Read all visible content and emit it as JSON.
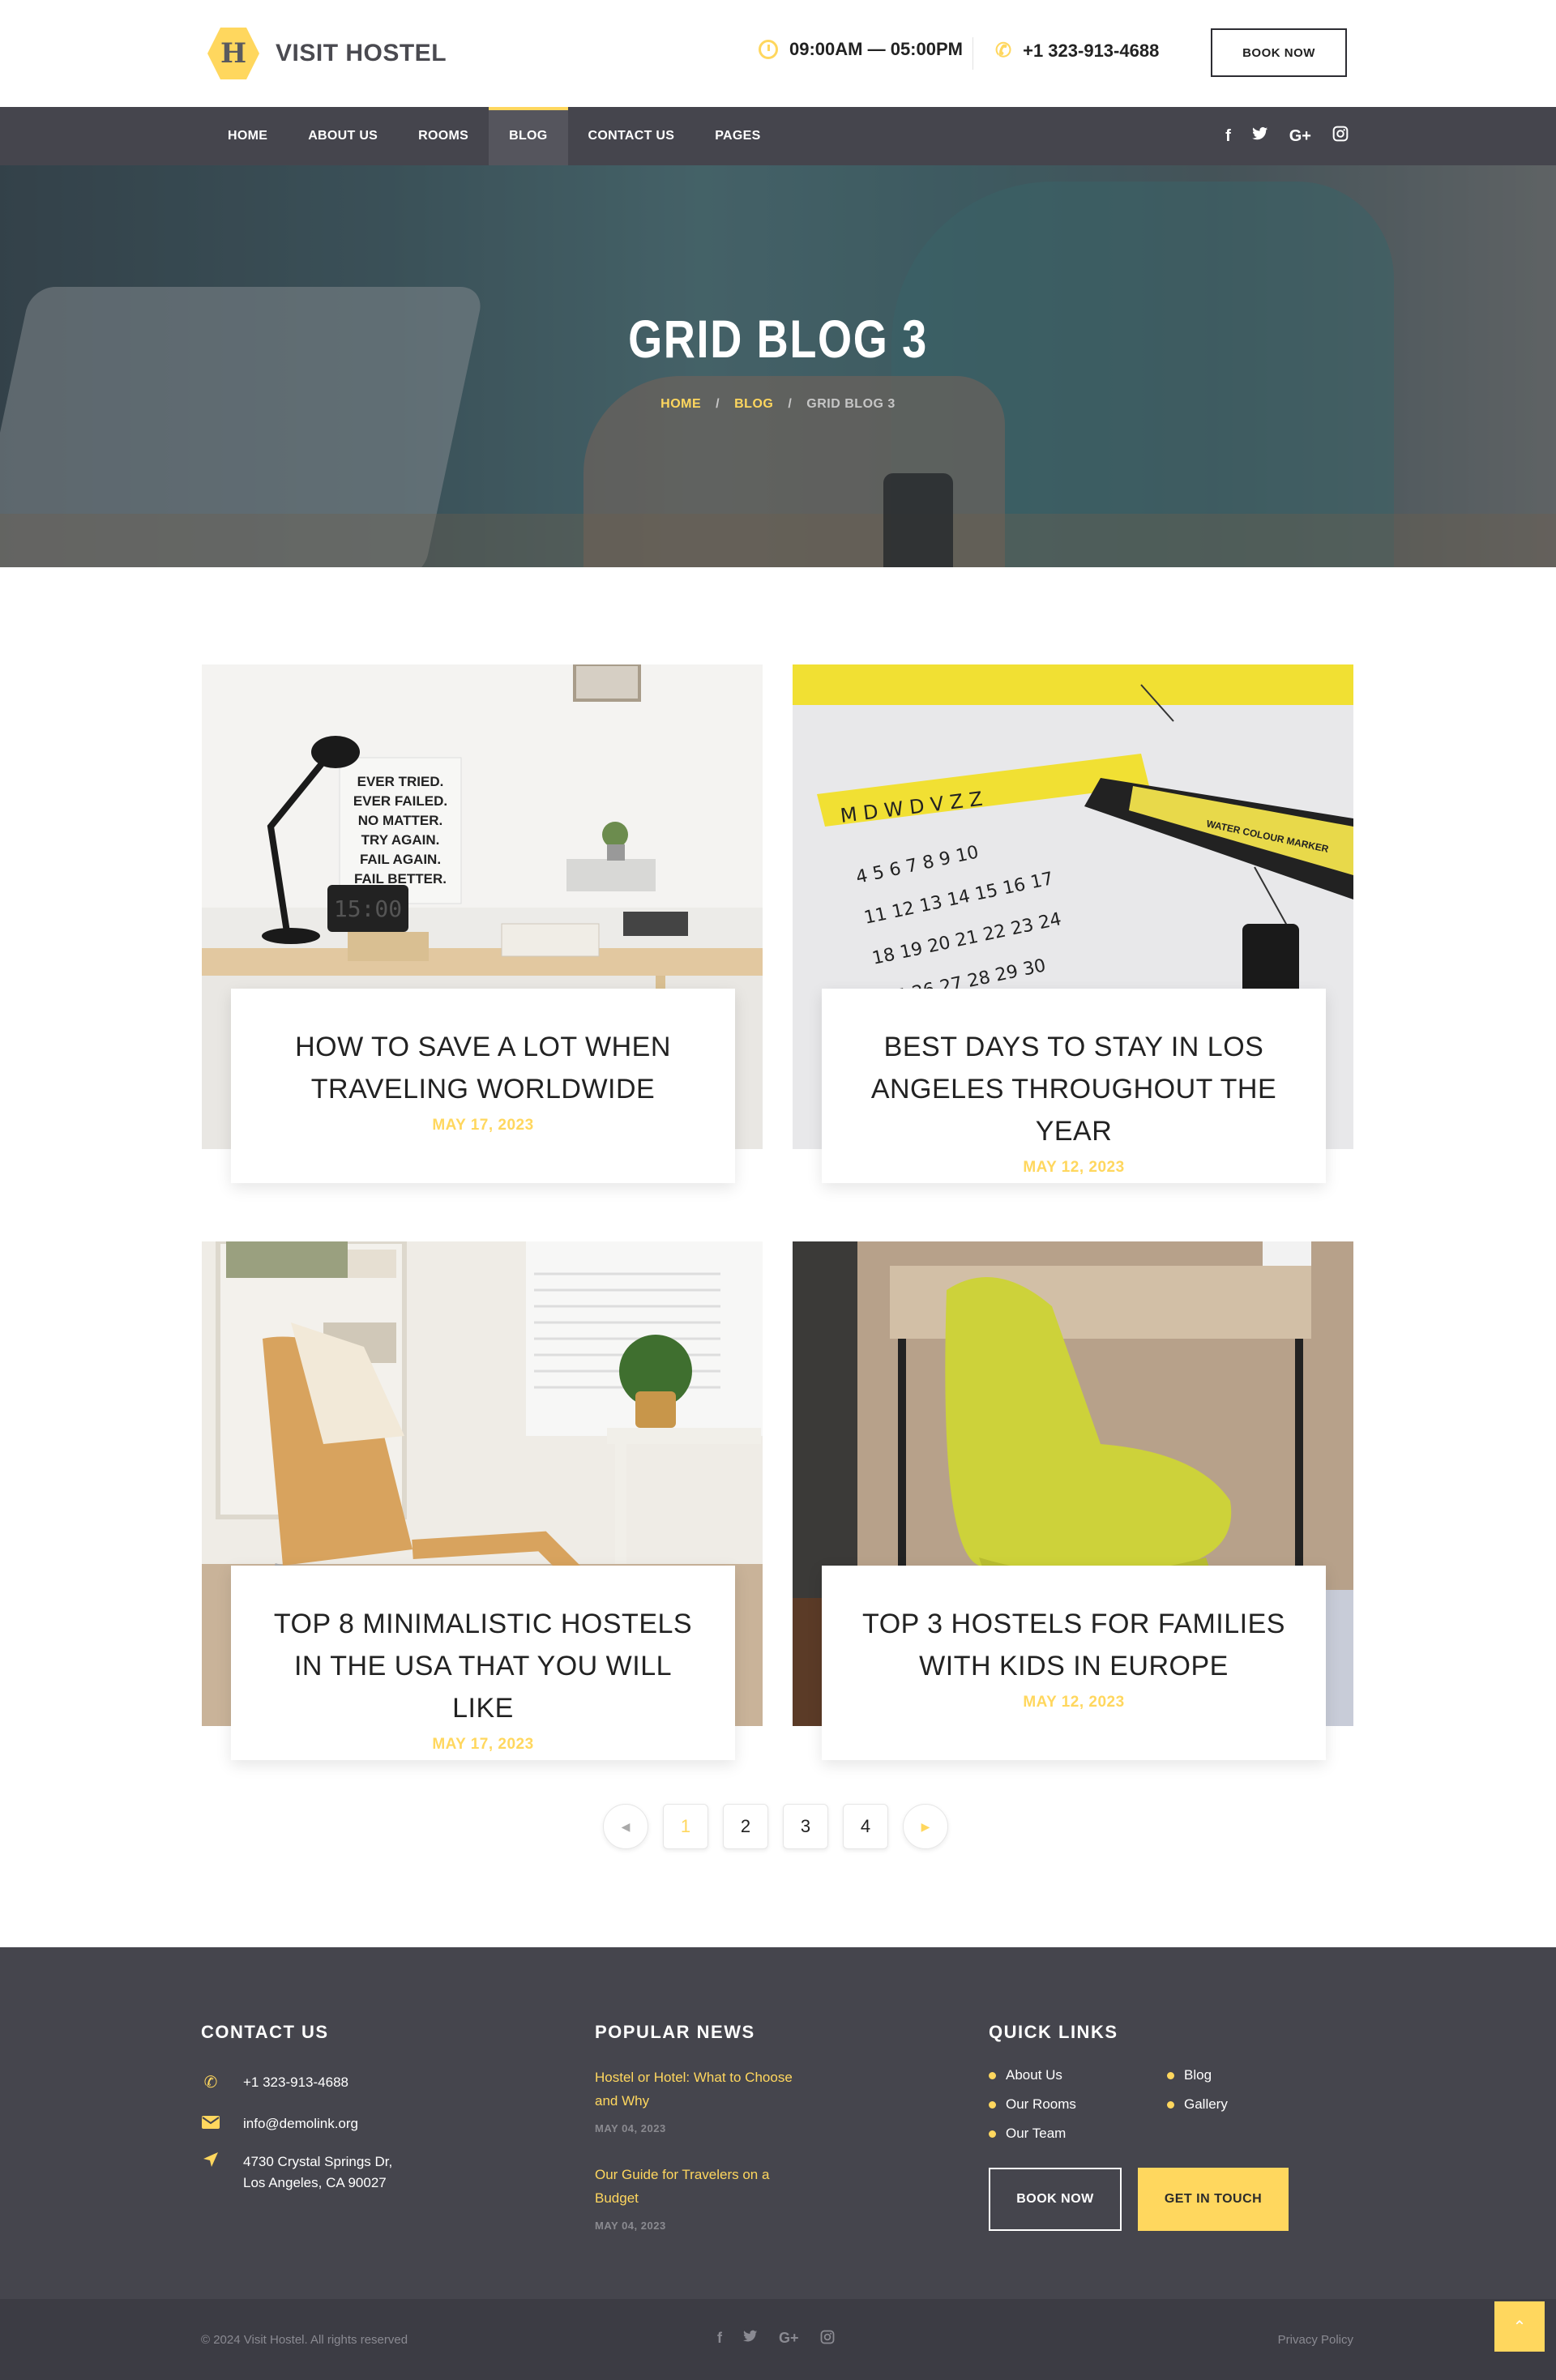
{
  "header": {
    "logo_text": "VISIT HOSTEL",
    "logo_letter": "H",
    "hours": "09:00AM — 05:00PM",
    "phone": "+1 323-913-4688",
    "book_button": "BOOK NOW"
  },
  "nav": {
    "items": [
      "HOME",
      "ABOUT US",
      "ROOMS",
      "BLOG",
      "CONTACT US",
      "PAGES"
    ],
    "active": "BLOG",
    "social_icons": [
      "facebook-icon",
      "twitter-icon",
      "google-plus-icon",
      "instagram-icon"
    ],
    "social_glyphs": [
      "f",
      "t",
      "G+",
      "◎"
    ]
  },
  "hero": {
    "title": "GRID BLOG 3",
    "breadcrumb": [
      "HOME",
      "BLOG",
      "GRID BLOG 3"
    ],
    "separator": "/"
  },
  "posts": [
    {
      "title": "HOW TO SAVE A LOT WHEN TRAVELING WORLDWIDE",
      "date": "MAY 17, 2023"
    },
    {
      "title": "BEST DAYS TO STAY IN LOS ANGELES THROUGHOUT THE YEAR",
      "date": "MAY 12, 2023"
    },
    {
      "title": "TOP 8 MINIMALISTIC HOSTELS IN THE USA THAT YOU WILL LIKE",
      "date": "MAY 17, 2023"
    },
    {
      "title": "TOP 3 HOSTELS FOR FAMILIES WITH KIDS IN EUROPE",
      "date": "MAY 12, 2023"
    }
  ],
  "image_text": {
    "poster": [
      "EVER TRIED.",
      "EVER FAILED.",
      "NO MATTER.",
      "TRY AGAIN.",
      "FAIL AGAIN.",
      "FAIL BETTER."
    ],
    "clock": "15:00",
    "calendar_days": "M D W D V Z Z",
    "marker_label": "WATER COLOUR MARKER"
  },
  "pagination": {
    "prev": "◀",
    "pages": [
      "1",
      "2",
      "3",
      "4"
    ],
    "current": "1",
    "next": "▶"
  },
  "footer": {
    "contact": {
      "heading": "CONTACT US",
      "phone": "+1 323-913-4688",
      "email": "info@demolink.org",
      "address_line1": "4730 Crystal Springs Dr,",
      "address_line2": "Los Angeles, CA 90027"
    },
    "news": {
      "heading": "POPULAR NEWS",
      "items": [
        {
          "title": "Hostel or Hotel: What to Choose and Why",
          "date": "MAY 04, 2023"
        },
        {
          "title": "Our Guide for Travelers on a Budget",
          "date": "MAY 04, 2023"
        }
      ]
    },
    "links": {
      "heading": "QUICK LINKS",
      "items": [
        "About Us",
        "Our Rooms",
        "Our Team",
        "Blog",
        "Gallery"
      ],
      "book_button": "BOOK NOW",
      "touch_button": "GET IN TOUCH"
    }
  },
  "bottom": {
    "copyright": "© 2024 Visit Hostel. All rights reserved",
    "privacy": "Privacy Policy",
    "social_glyphs": [
      "f",
      "t",
      "G+",
      "◎"
    ],
    "scroll_top": "⌃"
  },
  "colors": {
    "accent": "#ffd75e",
    "dark": "#45454d",
    "darker": "#3c3c44"
  }
}
